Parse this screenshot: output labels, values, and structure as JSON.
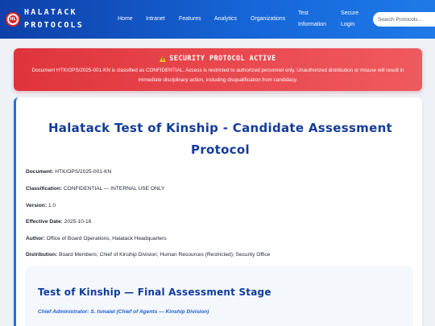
{
  "header": {
    "brand_line1": "HALATACK",
    "brand_line2": "PROTOCOLS",
    "logo_text": "HL",
    "nav": {
      "home": "Home",
      "intranet": "Intranet",
      "features": "Features",
      "analytics": "Analytics",
      "organizations": "Organizations",
      "test_info_1": "Test",
      "test_info_2": "Information",
      "secure_login_1": "Secure",
      "secure_login_2": "Login"
    },
    "search_placeholder": "Search Protocols..."
  },
  "alert": {
    "icon": "warning-icon",
    "title": "SECURITY PROTOCOL ACTIVE",
    "body": "Document HTK/OPS/2025-001-KN is classified as CONFIDENTIAL. Access is restricted to authorized personnel only. Unauthorized distribution or misuse will result in immediate disciplinary action, including disqualification from candidacy."
  },
  "document": {
    "title": "Halatack Test of Kinship - Candidate Assessment Protocol",
    "meta": [
      {
        "label": "Document:",
        "value": "HTK/OPS/2025-001-KN"
      },
      {
        "label": "Classification:",
        "value": "CONFIDENTIAL — INTERNAL USE ONLY"
      },
      {
        "label": "Version:",
        "value": "1.0"
      },
      {
        "label": "Effective Date:",
        "value": "2025-10-16"
      },
      {
        "label": "Author:",
        "value": "Office of Board Operations, Halatack Headquarters"
      },
      {
        "label": "Distribution:",
        "value": "Board Members; Chief of Kinship Division; Human Resources (Restricted); Security Office"
      }
    ],
    "section": {
      "title": "Test of Kinship — Final Assessment Stage",
      "subtitle": "Chief Administrator: S. Ismaiel (Chief of Agents — Kinship Division)"
    }
  },
  "colors": {
    "header_gradient_start": "#0e3fa8",
    "header_gradient_end": "#1f7ae8",
    "alert_red": "#e0343c",
    "title_blue": "#123c9a",
    "accent_blue": "#1f6fe0"
  }
}
